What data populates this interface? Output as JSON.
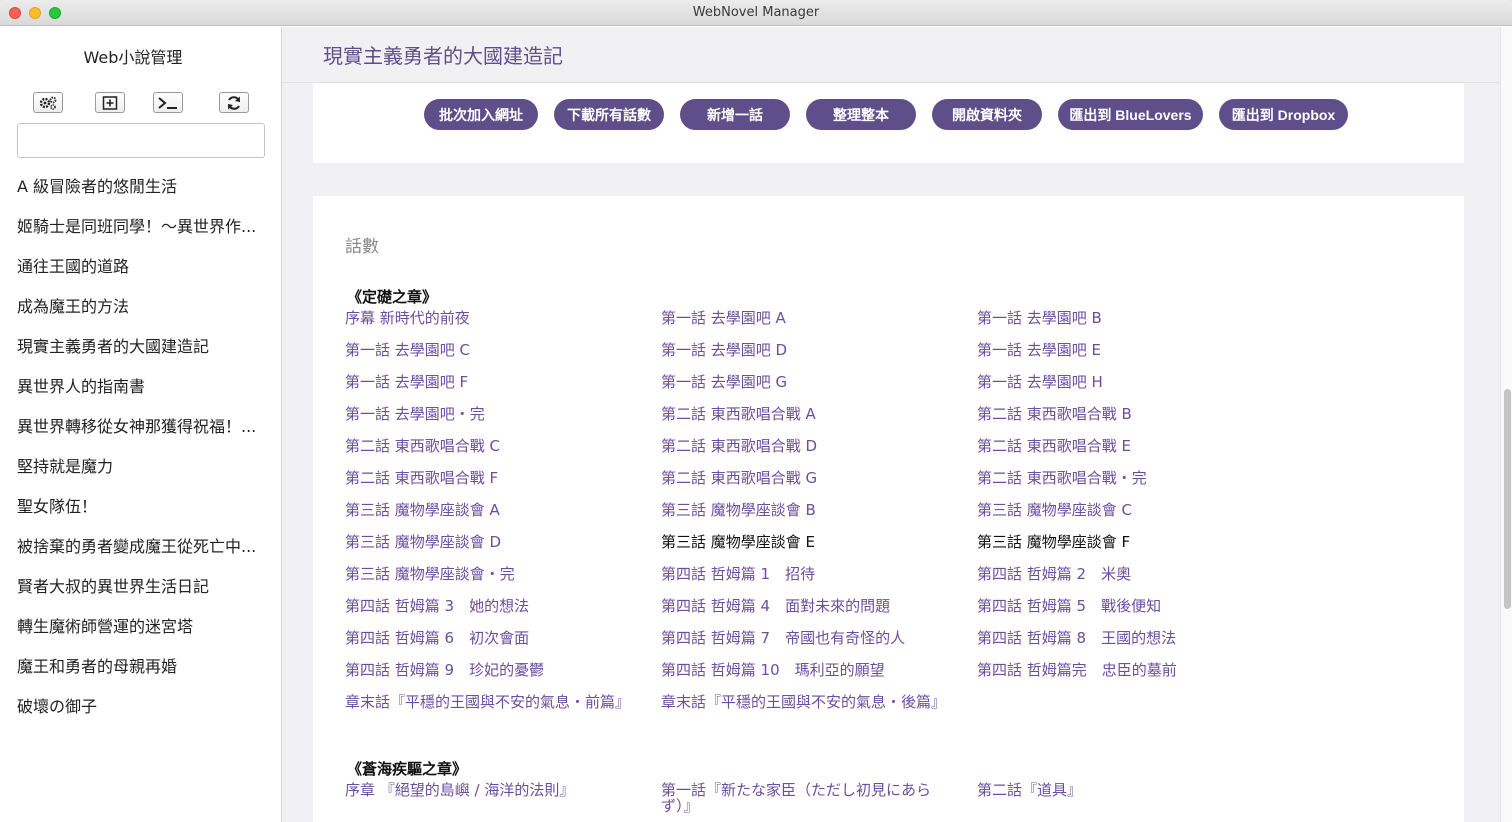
{
  "window": {
    "title": "WebNovel Manager"
  },
  "sidebar": {
    "title": "Web小說管理",
    "search": {
      "value": "",
      "placeholder": ""
    },
    "tools": [
      "gears-icon",
      "add-box-icon",
      "terminal-icon",
      "refresh-icon"
    ],
    "novels": [
      "A 級冒險者的悠閒生活",
      "姬騎士是同班同學！～異世界作...",
      "通往王國的道路",
      "成為魔王的方法",
      "現實主義勇者的大國建造記",
      "異世界人的指南書",
      "異世界轉移從女神那獲得祝福！...",
      "堅持就是魔力",
      "聖女隊伍！",
      "被捨棄的勇者變成魔王從死亡中...",
      "賢者大叔的異世界生活日記",
      "轉生魔術師營運的迷宮塔",
      "魔王和勇者的母親再婚",
      "破壞の御子"
    ]
  },
  "main": {
    "title": "現實主義勇者的大國建造記",
    "actions": [
      "批次加入網址",
      "下載所有話數",
      "新增一話",
      "整理整本",
      "開啟資料夾",
      "匯出到 BlueLovers",
      "匯出到 Dropbox"
    ],
    "section_label": "話數",
    "volumes": [
      {
        "title": "《定礎之章》",
        "chapters": [
          {
            "t": "序幕 新時代的前夜",
            "read": false
          },
          {
            "t": "第一話 去學園吧 A",
            "read": false
          },
          {
            "t": "第一話 去學園吧 B",
            "read": false
          },
          {
            "t": "第一話 去學園吧 C",
            "read": false
          },
          {
            "t": "第一話 去學園吧 D",
            "read": false
          },
          {
            "t": "第一話 去學園吧 E",
            "read": false
          },
          {
            "t": "第一話 去學園吧 F",
            "read": false
          },
          {
            "t": "第一話 去學園吧 G",
            "read": false
          },
          {
            "t": "第一話 去學園吧 H",
            "read": false
          },
          {
            "t": "第一話 去學園吧・完",
            "read": false
          },
          {
            "t": "第二話 東西歌唱合戰 A",
            "read": false
          },
          {
            "t": "第二話 東西歌唱合戰 B",
            "read": false
          },
          {
            "t": "第二話 東西歌唱合戰 C",
            "read": false
          },
          {
            "t": "第二話 東西歌唱合戰 D",
            "read": false
          },
          {
            "t": "第二話 東西歌唱合戰 E",
            "read": false
          },
          {
            "t": "第二話 東西歌唱合戰 F",
            "read": false
          },
          {
            "t": "第二話 東西歌唱合戰 G",
            "read": false
          },
          {
            "t": "第二話 東西歌唱合戰・完",
            "read": false
          },
          {
            "t": "第三話 魔物學座談會 A",
            "read": false
          },
          {
            "t": "第三話 魔物學座談會 B",
            "read": false
          },
          {
            "t": "第三話 魔物學座談會 C",
            "read": false
          },
          {
            "t": "第三話 魔物學座談會 D",
            "read": false
          },
          {
            "t": "第三話 魔物學座談會 E",
            "read": true
          },
          {
            "t": "第三話 魔物學座談會 F",
            "read": true
          },
          {
            "t": "第三話 魔物學座談會・完",
            "read": false
          },
          {
            "t": "第四話 哲姆篇 1　招待",
            "read": false
          },
          {
            "t": "第四話 哲姆篇 2　米奧",
            "read": false
          },
          {
            "t": "第四話 哲姆篇 3　她的想法",
            "read": false
          },
          {
            "t": "第四話 哲姆篇 4　面對未來的問題",
            "read": false
          },
          {
            "t": "第四話 哲姆篇 5　戰後便知",
            "read": false
          },
          {
            "t": "第四話 哲姆篇 6　初次會面",
            "read": false
          },
          {
            "t": "第四話 哲姆篇 7　帝國也有奇怪的人",
            "read": false
          },
          {
            "t": "第四話 哲姆篇 8　王國的想法",
            "read": false
          },
          {
            "t": "第四話 哲姆篇 9　珍妃的憂鬱",
            "read": false
          },
          {
            "t": "第四話 哲姆篇 10　瑪利亞的願望",
            "read": false
          },
          {
            "t": "第四話 哲姆篇完　忠臣的墓前",
            "read": false
          },
          {
            "t": "章末話『平穩的王國與不安的氣息・前篇』",
            "read": false,
            "tall": true
          },
          {
            "t": "章末話『平穩的王國與不安的氣息・後篇』",
            "read": false,
            "tall": true
          }
        ]
      },
      {
        "title": "《蒼海疾驅之章》",
        "chapters": [
          {
            "t": "序章 『絕望的島嶼 / 海洋的法則』",
            "read": false,
            "tall": true
          },
          {
            "t": "第一話『新たな家臣（ただし初見にあらず）』",
            "read": false,
            "tall": true
          },
          {
            "t": "第二話『道具』",
            "read": false,
            "tall": true
          }
        ]
      }
    ]
  },
  "colors": {
    "accent": "#5e4f8a",
    "link": "#6a4fa0",
    "read": "#111111"
  }
}
